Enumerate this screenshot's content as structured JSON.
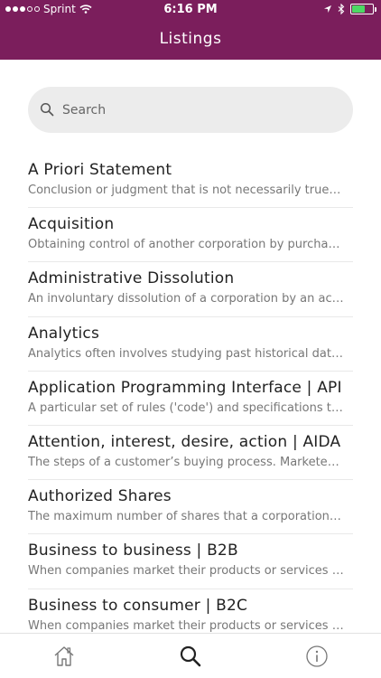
{
  "status_bar": {
    "carrier": "Sprint",
    "time": "6:16 PM",
    "signal_strength": "3 of 5",
    "battery_level": 0.65,
    "icons": [
      "signal-dots-icon",
      "wifi-icon",
      "location-arrow-icon",
      "bluetooth-icon",
      "battery-icon"
    ],
    "battery_color": "#4cd964"
  },
  "header": {
    "title": "Listings",
    "background_color": "#7b1e5c"
  },
  "search": {
    "placeholder": "Search",
    "value": "",
    "icon": "search-icon"
  },
  "listings": [
    {
      "title": "A Priori Statement",
      "description": "Conclusion or judgment that is not necessarily true, th..."
    },
    {
      "title": "Acquisition",
      "description": "Obtaining control of another corporation by purchasi..."
    },
    {
      "title": "Administrative Dissolution",
      "description": "An involuntary dissolution of a corporation by an act o..."
    },
    {
      "title": "Analytics",
      "description": "Analytics often involves studying past historical data t..."
    },
    {
      "title": "Application Programming Interface | API",
      "description": "A particular set of rules ('code') and specifications that..."
    },
    {
      "title": "Attention, interest, desire, action | AIDA",
      "description": "The steps of a customer’s buying process. Marketers a..."
    },
    {
      "title": "Authorized Shares",
      "description": "The maximum number of shares that a corporation m..."
    },
    {
      "title": "Business to business | B2B",
      "description": "When companies market their products or services to..."
    },
    {
      "title": "Business to consumer | B2C",
      "description": "When companies market their products or services di..."
    }
  ],
  "tab_bar": {
    "tabs": [
      {
        "name": "home",
        "icon": "home-icon"
      },
      {
        "name": "search",
        "icon": "search-icon"
      },
      {
        "name": "info",
        "icon": "info-icon"
      }
    ]
  }
}
